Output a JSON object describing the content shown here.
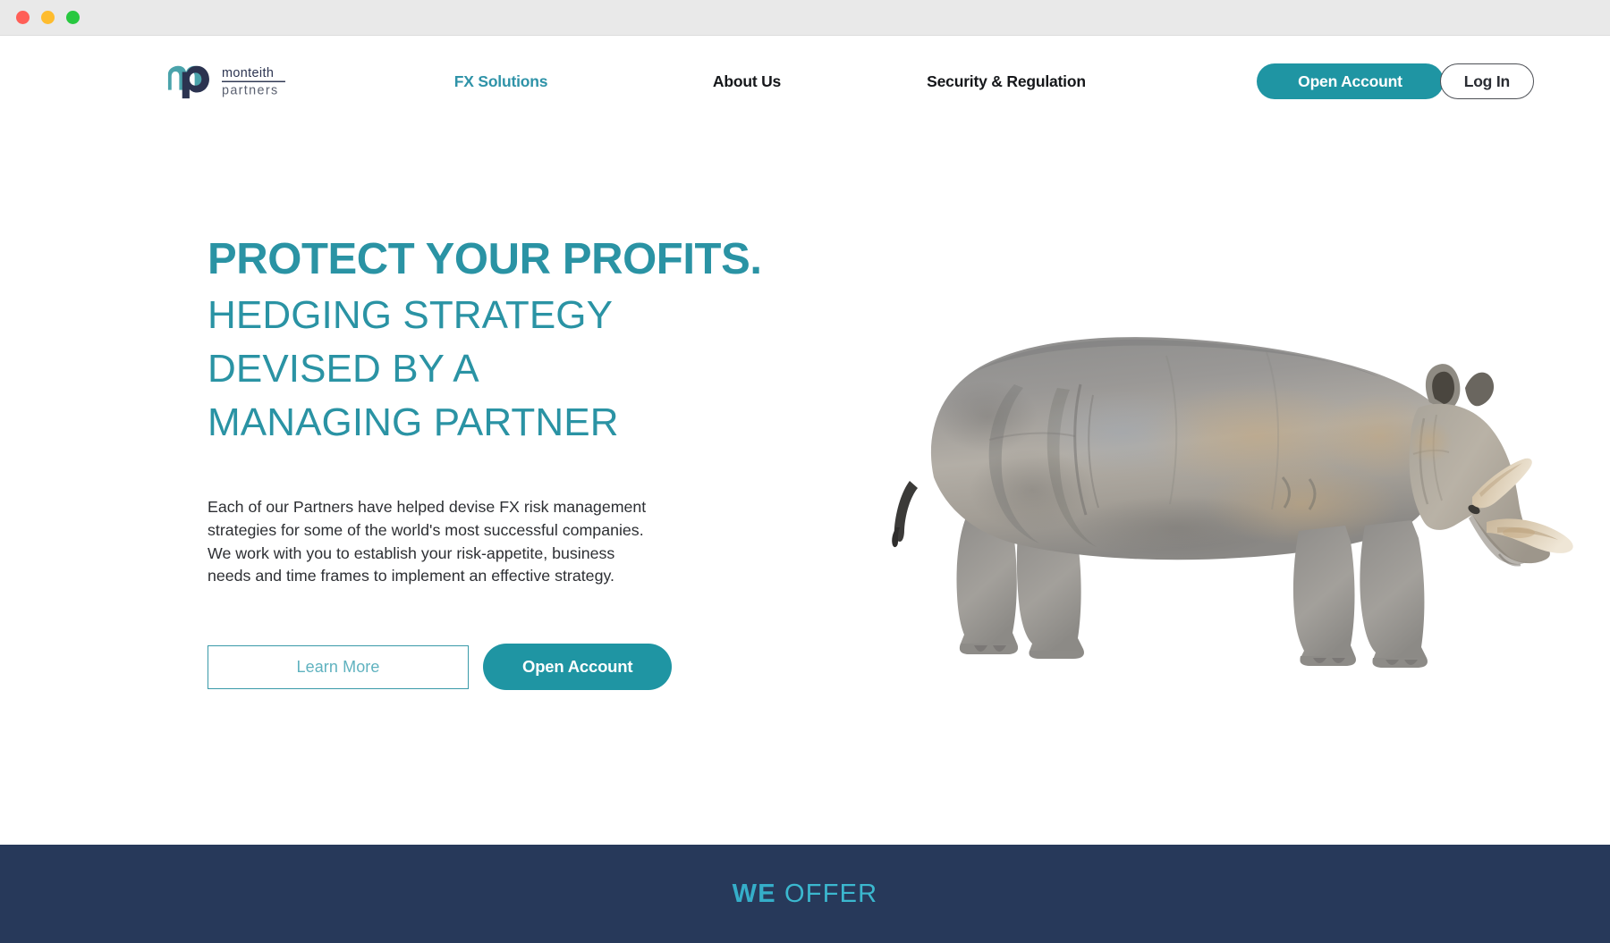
{
  "window": {
    "traffic_lights": [
      "close",
      "minimize",
      "zoom"
    ],
    "colors": {
      "titlebar_bg": "#e9e9e9",
      "close": "#ff5f57",
      "minimize": "#febc2e",
      "zoom": "#28c840"
    }
  },
  "brand": {
    "monogram": "mp",
    "name_line1": "monteith",
    "name_line2": "partners",
    "mark_color_teal": "#4aa3ab",
    "mark_color_navy": "#2b3350"
  },
  "nav": {
    "items": [
      {
        "label": "FX Solutions",
        "active": true
      },
      {
        "label": "About Us",
        "active": false
      },
      {
        "label": "Security & Regulation",
        "active": false
      }
    ],
    "open_account_label": "Open Account",
    "login_label": "Log In"
  },
  "hero": {
    "title": "PROTECT YOUR PROFITS.",
    "subtitle": "HEDGING STRATEGY\nDEVISED BY A\nMANAGING PARTNER",
    "paragraph": "Each of our Partners have helped devise FX risk management strategies for some of the world's most successful companies. We work with you to establish your risk-appetite, business needs and time frames to implement an effective strategy.",
    "learn_more_label": "Learn More",
    "open_account_label": "Open Account",
    "artwork": "rhinoceros-photo"
  },
  "offer_section": {
    "title_bold": "WE",
    "title_light": "OFFER",
    "background": "#27395a",
    "text_color": "#35aec9"
  },
  "theme": {
    "teal": "#2a93a4",
    "teal_button": "#1f95a3",
    "navy": "#27395a",
    "body_text": "#2d2f33"
  }
}
